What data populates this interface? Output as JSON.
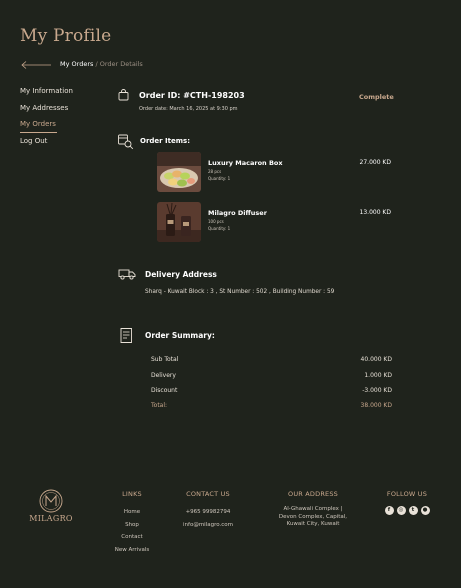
{
  "page": {
    "title": "My Profile"
  },
  "breadcrumb": {
    "parent": "My Orders",
    "separator": "/",
    "current": "Order Details"
  },
  "sidebar": {
    "items": [
      {
        "label": "My Information"
      },
      {
        "label": "My Addresses"
      },
      {
        "label": "My Orders",
        "active": true
      },
      {
        "label": "Log Out"
      }
    ]
  },
  "order": {
    "id": "Order ID: #CTH-198203",
    "date": "Order date: March 16, 2025 at 9:30 pm",
    "status": "Complete"
  },
  "items_section": {
    "heading": "Order Items:"
  },
  "items": [
    {
      "name": "Luxury Macaron Box",
      "size": "28 pcs",
      "quantity": "Quantity: 1",
      "price": "27.000 KD",
      "thumb_icon": "macaron-box-image"
    },
    {
      "name": "Milagro Diffuser",
      "size": "100 pcs",
      "quantity": "Quantity: 1",
      "price": "13.000 KD",
      "thumb_icon": "diffuser-image"
    }
  ],
  "delivery": {
    "heading": "Delivery Address",
    "address": "Sharq - Kuwait Block : 3 , St Number : 502 , Building Number : 59"
  },
  "summary": {
    "heading": "Order Summary:",
    "rows": [
      {
        "label": "Sub Total",
        "value": "40.000 KD"
      },
      {
        "label": "Delivery",
        "value": "1.000 KD"
      },
      {
        "label": "Discount",
        "value": "-3.000 KD"
      },
      {
        "label": "Total:",
        "value": "38.000 KD"
      }
    ]
  },
  "footer": {
    "brand": "MILAGRO",
    "links": {
      "heading": "LINKS",
      "items": [
        "Home",
        "Shop",
        "Contact",
        "New Arrivals"
      ]
    },
    "contact": {
      "heading": "CONTACT US",
      "phone": "+965 99982794",
      "email": "info@milagro.com"
    },
    "address": {
      "heading": "OUR ADDRESS",
      "lines": [
        "Al-Ghawali Complex |",
        "Devon Complex, Capital,",
        "Kuwait City, Kuwait"
      ]
    },
    "follow": {
      "heading": "FOLLOW US",
      "icons": [
        "facebook-icon",
        "instagram-icon",
        "twitter-icon",
        "snapchat-icon"
      ]
    }
  },
  "colors": {
    "background": "#1f231c",
    "accent": "#c9a98e",
    "text": "#e9e2d8"
  }
}
